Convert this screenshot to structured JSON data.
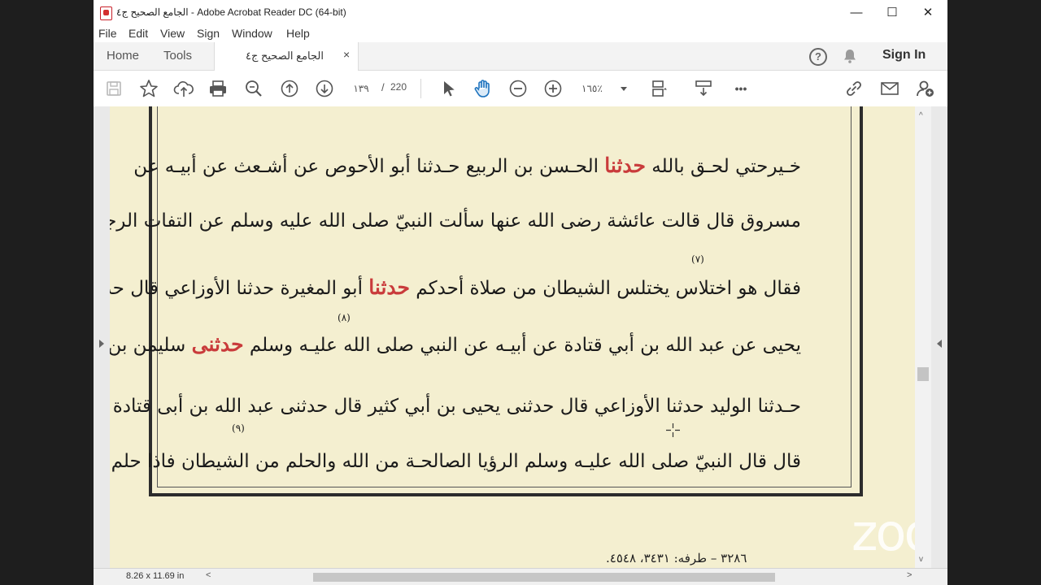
{
  "window": {
    "title": "الجامع الصحيح ج٤ - Adobe Acrobat Reader DC (64-bit)",
    "minimize_glyph": "—",
    "maximize_glyph": "☐",
    "close_glyph": "✕"
  },
  "menu": [
    "File",
    "Edit",
    "View",
    "Sign",
    "Window",
    "Help"
  ],
  "tabs": {
    "home": "Home",
    "tools": "Tools",
    "document": "الجامع الصحيح ج٤",
    "close_glyph": "×"
  },
  "header_right": {
    "help_glyph": "?",
    "sign_in": "Sign In"
  },
  "toolbar": {
    "icons": [
      "save-icon",
      "star-icon",
      "upload-icon",
      "print-icon",
      "zoom-search-icon",
      "page-up-icon",
      "page-down-icon",
      "select-arrow-icon",
      "hand-icon",
      "zoom-out-icon",
      "zoom-in-icon",
      "fit-page-icon",
      "scroll-mode-icon",
      "more-icon",
      "link-icon",
      "mail-icon",
      "add-user-icon"
    ],
    "current_page": "١٣٩",
    "page_separator": "/",
    "total_pages": "220",
    "zoom_value": "١٦٥٪",
    "more_glyph": "•••"
  },
  "document": {
    "lines": [
      [
        {
          "t": "خـيرحتي لحـق بالله "
        },
        {
          "t": "الحـسن بن الربيع حـدثنا أبو الأحوص عن أشـعث عن أبيـه عن"
        }
      ],
      [
        {
          "t": "مسروق قال قالت عائشة رضى الله عنها سألت النبيّ صلى الله عليه وسلم عن التفات الرجل في الصلاة"
        }
      ],
      [
        {
          "t": "فقال هو اختلاس يختلس الشيطان من صلاة أحدكم "
        },
        {
          "t": "أبو المغيرة حدثنا الأوزاعي قال حدثنى"
        }
      ],
      [
        {
          "t": "يحيى عن عبد الله بن أبي قتادة عن أبيـه عن النبي صلى الله عليـه وسلم "
        },
        {
          "t": "سليمن بن عبد الرحمن"
        }
      ],
      [
        {
          "t": "حـدثنا الوليد حدثنا الأوزاعي قال حدثنى يحيى بن أبي كثير قال حدثنى عبد الله بن أبى قتادة عن أبيه"
        }
      ],
      [
        {
          "t": "قال قال النبيّ صلى الله عليـه وسلم الرؤيا الصالحـة من الله والحلم من الشيطان فاذا حلم أحدكم"
        }
      ]
    ],
    "red_markers": [
      "حدثنا",
      "حدثنا",
      "حدثنى"
    ],
    "note_numbers": [
      "(٧)",
      "(٨)",
      "(٩)"
    ],
    "footnote": "٣٢٨٦ – طرفه: ٣٤٣١، ٤٥٤٨."
  },
  "overlay": {
    "watermark": "zoom"
  },
  "status": {
    "page_size": "8.26 x 11.69 in",
    "scroll_left": "<",
    "scroll_right": ">",
    "scroll_up": "^",
    "scroll_down": "v"
  },
  "colors": {
    "page_background": "#f4efd0",
    "red_marker": "#c93b3b",
    "frame": "#2c2c2c"
  }
}
